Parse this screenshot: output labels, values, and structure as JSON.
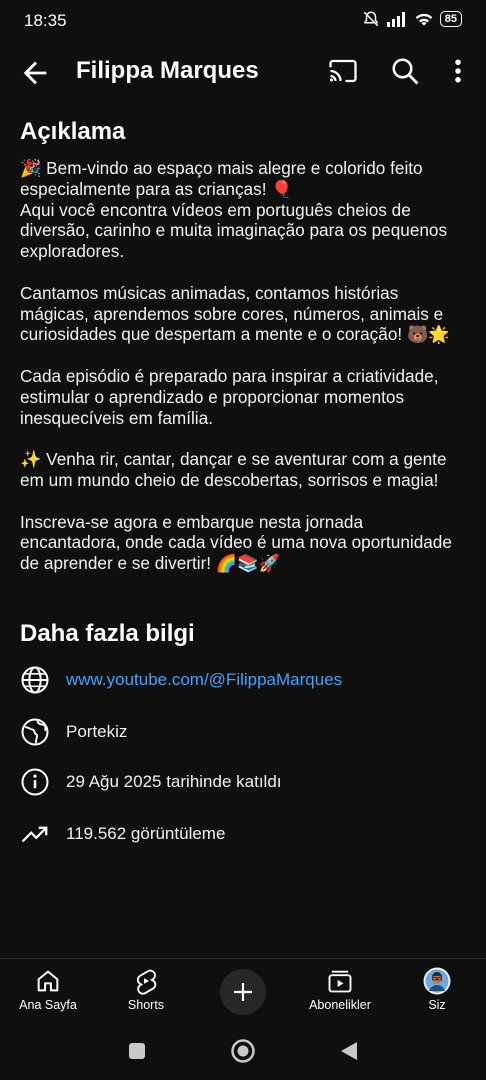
{
  "status": {
    "time": "18:35",
    "battery": "85"
  },
  "app_bar": {
    "title": "Filippa Marques"
  },
  "about": {
    "heading": "Açıklama",
    "description": "🎉 Bem-vindo ao espaço mais alegre e colorido feito especialmente para as crianças! 🎈\nAqui você encontra vídeos em português cheios de diversão, carinho e muita imaginação para os pequenos exploradores.\n\nCantamos músicas animadas, contamos histórias mágicas, aprendemos sobre cores, números, animais e curiosidades que despertam a mente e o coração! 🐻🌟\n\nCada episódio é preparado para inspirar a criatividade, estimular o aprendizado e proporcionar momentos inesquecíveis em família.\n\n✨ Venha rir, cantar, dançar e se aventurar com a gente em um mundo cheio de descobertas, sorrisos e magia!\n\nInscreva-se agora e embarque nesta jornada encantadora, onde cada vídeo é uma nova oportunidade de aprender e se divertir! 🌈📚🚀"
  },
  "more_info": {
    "heading": "Daha fazla bilgi",
    "link": "www.youtube.com/@FilippaMarques",
    "country": "Portekiz",
    "joined": "29 Ağu 2025 tarihinde katıldı",
    "views": "119.562 görüntüleme"
  },
  "bottom_nav": {
    "home": "Ana Sayfa",
    "shorts": "Shorts",
    "subscriptions": "Abonelikler",
    "you": "Siz"
  },
  "icons": [
    "back-arrow-icon",
    "cast-icon",
    "search-icon",
    "more-vert-icon",
    "globe-icon",
    "earth-icon",
    "info-icon",
    "trending-icon",
    "home-icon",
    "shorts-icon",
    "plus-icon",
    "subscriptions-icon",
    "avatar"
  ],
  "colors": {
    "background": "#0f0f0f",
    "text": "#f1f1f1",
    "link": "#3ea6ff",
    "divider": "#272727"
  }
}
